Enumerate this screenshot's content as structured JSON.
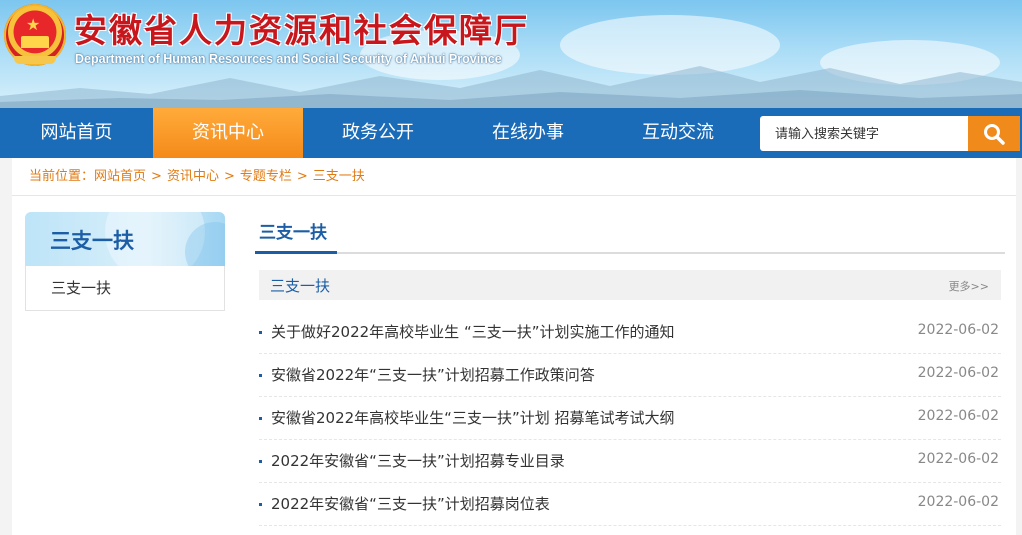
{
  "header": {
    "title": "安徽省人力资源和社会保障厅",
    "subtitle": "Department of Human Resources and Social Security of Anhui Province",
    "emblem_icon": "national-emblem-icon"
  },
  "nav": {
    "items": [
      {
        "label": "网站首页"
      },
      {
        "label": "资讯中心",
        "active": true
      },
      {
        "label": "政务公开"
      },
      {
        "label": "在线办事"
      },
      {
        "label": "互动交流"
      }
    ],
    "search_placeholder": "请输入搜索关键字",
    "search_icon": "search-icon"
  },
  "breadcrumb": {
    "prefix": "当前位置：",
    "items": [
      "网站首页",
      "资讯中心",
      "专题专栏",
      "三支一扶"
    ],
    "separator": ">"
  },
  "sidebar": {
    "title": "三支一扶",
    "items": [
      {
        "label": "三支一扶"
      }
    ]
  },
  "main": {
    "tab": "三支一扶",
    "section_title": "三支一扶",
    "more_label": "更多>>",
    "news": [
      {
        "title": "关于做好2022年高校毕业生 “三支一扶”计划实施工作的通知",
        "date": "2022-06-02"
      },
      {
        "title": "安徽省2022年“三支一扶”计划招募工作政策问答",
        "date": "2022-06-02"
      },
      {
        "title": "安徽省2022年高校毕业生“三支一扶”计划 招募笔试考试大纲",
        "date": "2022-06-02"
      },
      {
        "title": "2022年安徽省“三支一扶”计划招募专业目录",
        "date": "2022-06-02"
      },
      {
        "title": "2022年安徽省“三支一扶”计划招募岗位表",
        "date": "2022-06-02"
      }
    ]
  },
  "colors": {
    "nav_bg": "#1a6bb8",
    "nav_active": "#f48a19",
    "title_red": "#c8161d",
    "link_blue": "#1c5ea5",
    "crumb_orange": "#e07b14"
  }
}
